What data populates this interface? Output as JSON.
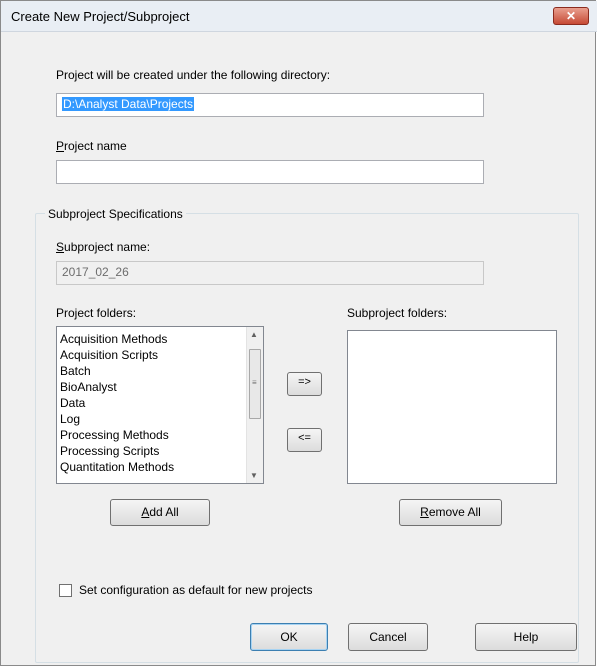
{
  "window": {
    "title": "Create New Project/Subproject",
    "close_label": "✕"
  },
  "directory": {
    "label": "Project will be created under the following directory:",
    "value": "D:\\Analyst Data\\Projects"
  },
  "project_name": {
    "label_underline": "P",
    "label_rest": "roject name",
    "value": ""
  },
  "subproject": {
    "group_title": "Subproject Specifications",
    "name_label_underline": "S",
    "name_label_rest": "ubproject name:",
    "name_value": "2017_02_26",
    "project_folders_label": "Project folders:",
    "subproject_folders_label": "Subproject folders:",
    "project_folders": [
      "Acquisition Methods",
      "Acquisition Scripts",
      "Batch",
      "BioAnalyst",
      "Data",
      "Log",
      "Processing Methods",
      "Processing Scripts",
      "Quantitation Methods"
    ],
    "subproject_folders": [],
    "add_button": "=>",
    "remove_button": "<=",
    "add_all_underline": "A",
    "add_all_rest": "dd All",
    "remove_all_underline": "R",
    "remove_all_rest": "emove All"
  },
  "default_config": {
    "label": "Set configuration as default for new projects",
    "checked": false
  },
  "buttons": {
    "ok": "OK",
    "cancel": "Cancel",
    "help": "Help"
  }
}
